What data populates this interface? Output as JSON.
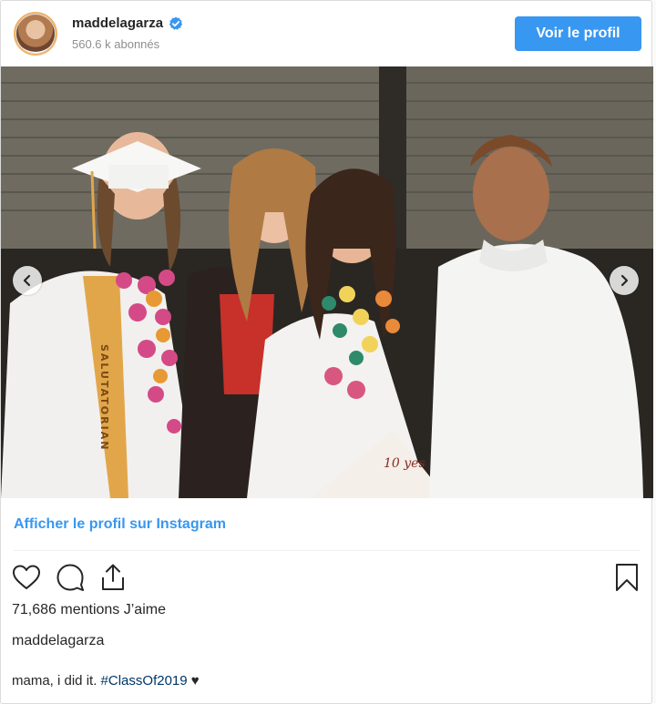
{
  "header": {
    "username": "maddelagarza",
    "followers": "560.6 k abonnés",
    "view_profile_label": "Voir le profil"
  },
  "photo": {
    "description_icon": "photo-image",
    "sash_text": "SALUTATORIAN",
    "sign_text": "10 yes"
  },
  "footer": {
    "instagram_link": "Afficher le profil sur Instagram",
    "likes": "71,686 mentions J’aime",
    "caption_username": "maddelagarza",
    "caption_text": "mama, i did it.",
    "hashtag": "#ClassOf2019",
    "heart": "♥"
  },
  "icons": {
    "like": "heart-icon",
    "comment": "comment-icon",
    "share": "share-icon",
    "save": "bookmark-icon",
    "verified": "verified-badge-icon",
    "prev": "chevron-left-icon",
    "next": "chevron-right-icon"
  },
  "colors": {
    "accent": "#3897f0",
    "text": "#262626",
    "muted": "#8e8e8e"
  }
}
